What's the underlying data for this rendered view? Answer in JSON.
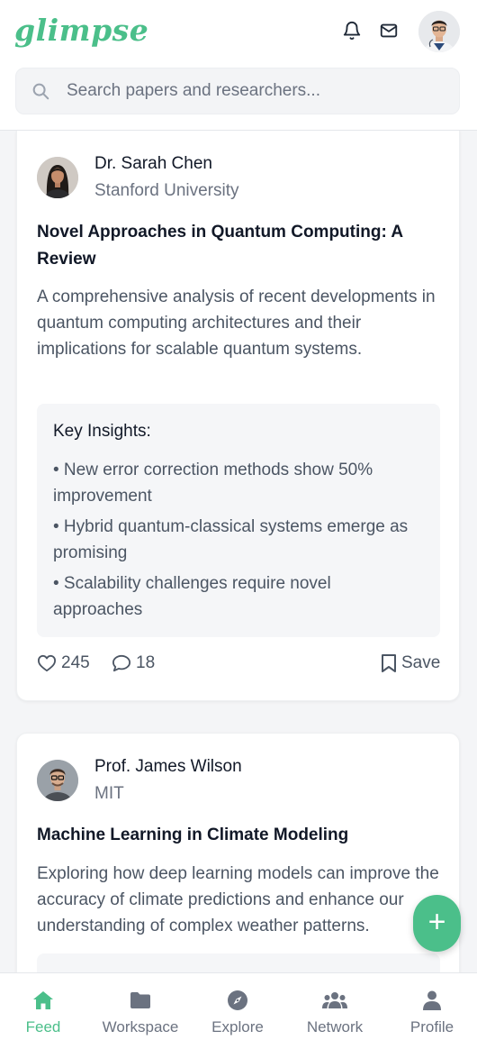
{
  "app": {
    "logo": "glimpse",
    "brand_color": "#4bbf8a"
  },
  "search": {
    "placeholder": "Search papers and researchers..."
  },
  "posts": [
    {
      "author": "Dr. Sarah Chen",
      "affiliation": "Stanford University",
      "title": "Novel Approaches in Quantum Computing: A Review",
      "description": "A comprehensive analysis of recent developments in quantum computing architectures and their implications for scalable quantum systems.",
      "insights_title": "Key Insights:",
      "insights": [
        "• New error correction methods show 50% improvement",
        "• Hybrid quantum-classical systems emerge as promising",
        "• Scalability challenges require novel approaches"
      ],
      "likes": "245",
      "comments": "18",
      "save_label": "Save"
    },
    {
      "author": "Prof. James Wilson",
      "affiliation": "MIT",
      "title": "Machine Learning in Climate Modeling",
      "description": "Exploring how deep learning models can improve the accuracy of climate predictions and enhance our understanding of complex weather patterns."
    }
  ],
  "fab": {
    "icon": "plus-icon",
    "label": "+"
  },
  "nav": {
    "items": [
      {
        "label": "Feed",
        "icon": "home-icon",
        "active": true
      },
      {
        "label": "Workspace",
        "icon": "folder-icon",
        "active": false
      },
      {
        "label": "Explore",
        "icon": "compass-icon",
        "active": false
      },
      {
        "label": "Network",
        "icon": "users-icon",
        "active": false
      },
      {
        "label": "Profile",
        "icon": "user-icon",
        "active": false
      }
    ]
  }
}
